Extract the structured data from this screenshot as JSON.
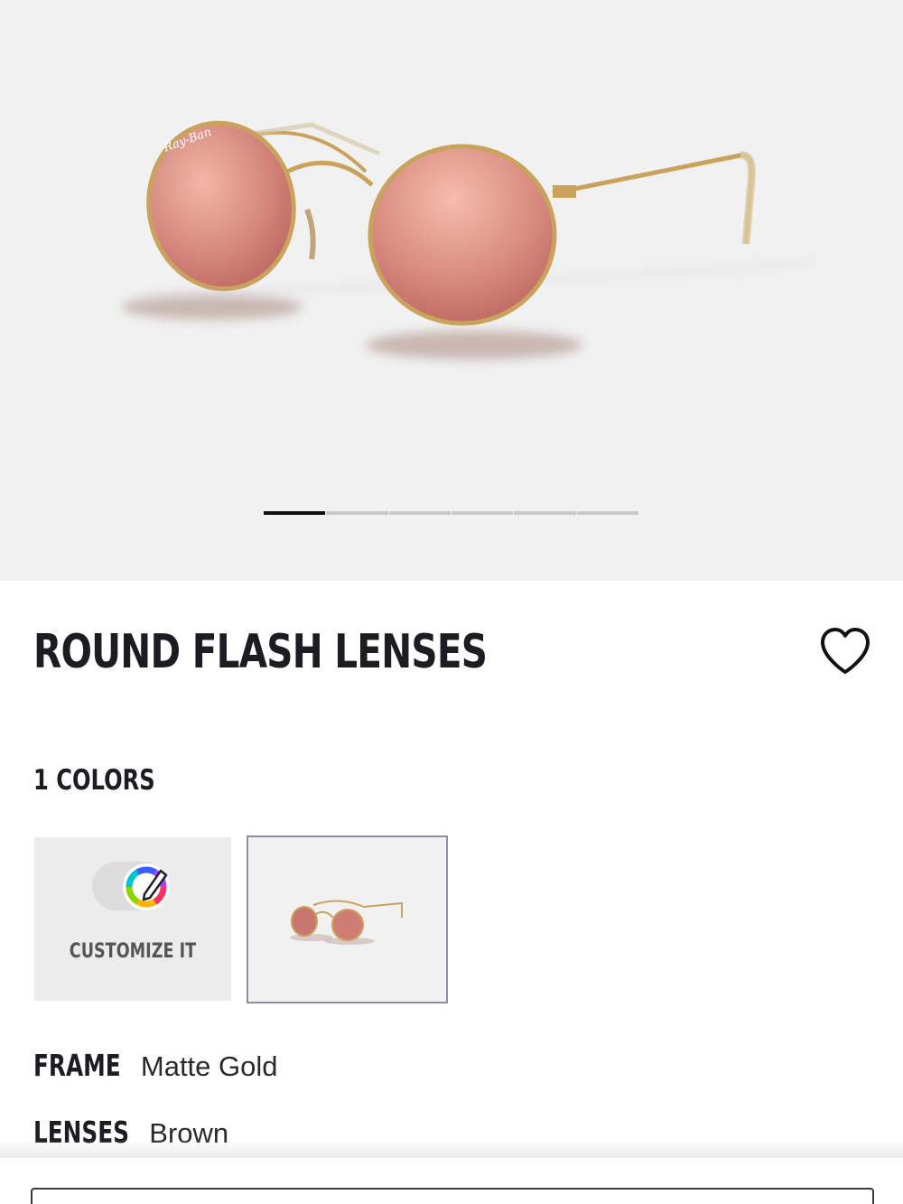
{
  "gallery": {
    "image_alt": "Round Flash Lenses sunglasses with matte gold frame and pink flash lenses",
    "slides": 6,
    "active_slide": 1
  },
  "product": {
    "title": "ROUND FLASH LENSES",
    "favorite_icon": "heart-outline-icon"
  },
  "colors": {
    "count_label": "1 COLORS",
    "customize_label": "CUSTOMIZE IT",
    "customize_icon": "color-wheel-pencil-icon"
  },
  "attributes": {
    "frame_label": "FRAME",
    "frame_value": "Matte Gold",
    "lenses_label": "LENSES",
    "lenses_value": "Brown"
  },
  "colors_palette": {
    "hero_background": "#f1f1f1",
    "frame_gold": "#c9a25c",
    "lens_pink": "#c9766f",
    "selected_border": "#8f8aa8"
  }
}
